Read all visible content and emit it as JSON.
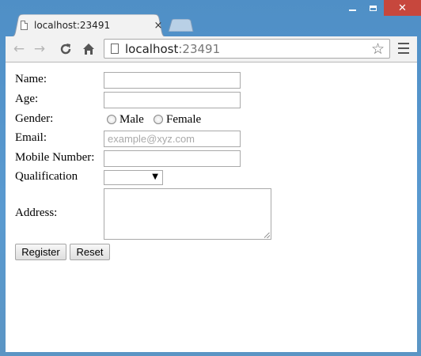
{
  "window": {
    "tab_title": "localhost:23491",
    "tab_close": "×",
    "controls": {
      "close": "✕"
    }
  },
  "toolbar": {
    "back": "←",
    "forward": "→",
    "reload": "C",
    "home": "⌂",
    "url_host": "localhost",
    "url_port": ":23491",
    "star": "☆"
  },
  "form": {
    "name_label": "Name:",
    "age_label": "Age:",
    "gender_label": "Gender:",
    "gender_options": [
      "Male",
      "Female"
    ],
    "email_label": "Email:",
    "email_placeholder": "example@xyz.com",
    "mobile_label": "Mobile Number:",
    "qualification_label": "Qualification",
    "qualification_value": "",
    "select_arrow": "▼",
    "address_label": "Address:",
    "register_button": "Register",
    "reset_button": "Reset"
  },
  "colors": {
    "titlebar": "#5b95c4",
    "close_button": "#c7473d",
    "chrome": "#f2f2f2"
  }
}
